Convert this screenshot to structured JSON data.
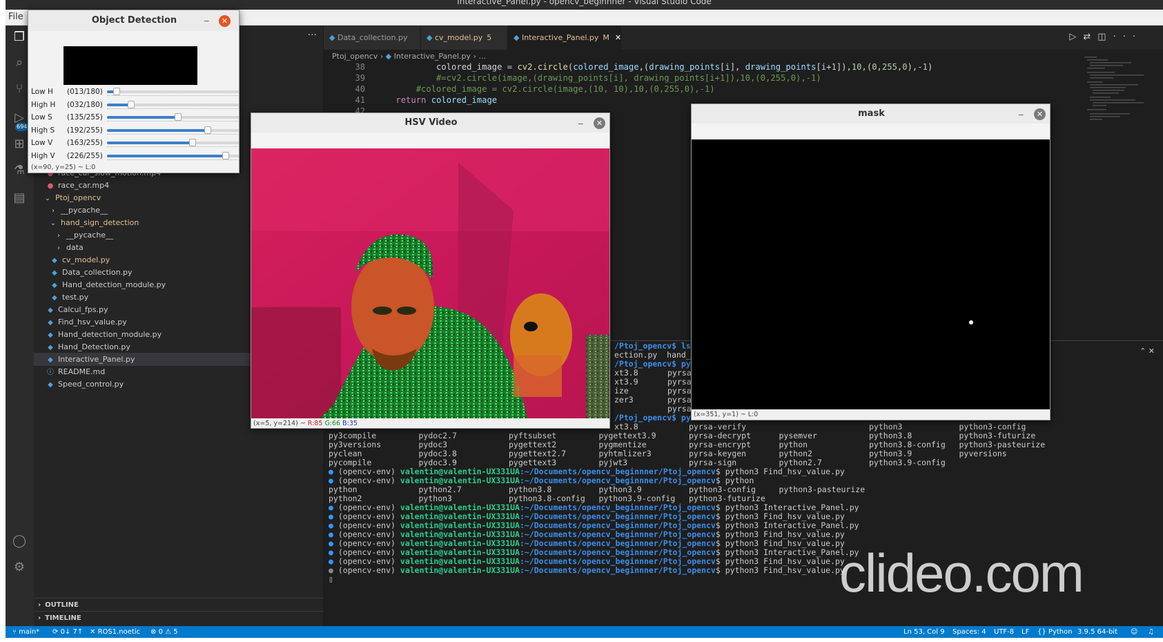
{
  "window_title": "Interactive_Panel.py - opencv_beginnner - Visual Studio Code",
  "menu": {
    "file": "File"
  },
  "activity": {
    "badge": "694"
  },
  "sidebar": {
    "more": "···",
    "files": [
      {
        "label": "race_car_slow_motion.mp4",
        "type": "mp4"
      },
      {
        "label": "race_car.mp4",
        "type": "mp4"
      },
      {
        "label": "Ptoj_opencv",
        "type": "folder-open"
      },
      {
        "label": "__pycache__",
        "type": "folder"
      },
      {
        "label": "hand_sign_detection",
        "type": "folder-open"
      },
      {
        "label": "__pycache__",
        "type": "folder"
      },
      {
        "label": "data",
        "type": "folder"
      },
      {
        "label": "cv_model.py",
        "type": "py"
      },
      {
        "label": "Data_collection.py",
        "type": "py"
      },
      {
        "label": "Hand_detection_module.py",
        "type": "py"
      },
      {
        "label": "test.py",
        "type": "py"
      },
      {
        "label": "Calcul_fps.py",
        "type": "py"
      },
      {
        "label": "Find_hsv_value.py",
        "type": "py"
      },
      {
        "label": "Hand_detection_module.py",
        "type": "py"
      },
      {
        "label": "Hand_Detection.py",
        "type": "py"
      },
      {
        "label": "Interactive_Panel.py",
        "type": "py"
      },
      {
        "label": "README.md",
        "type": "info"
      },
      {
        "label": "Speed_control.py",
        "type": "py"
      }
    ],
    "outline": "OUTLINE",
    "timeline": "TIMELINE"
  },
  "tabs": [
    {
      "label": "Data_collection.py",
      "status": ""
    },
    {
      "label": "cv_model.py",
      "status": "5"
    },
    {
      "label": "Interactive_Panel.py",
      "status": "M"
    }
  ],
  "breadcrumb": [
    "Ptoj_opencv",
    "Interactive_Panel.py",
    "..."
  ],
  "code": {
    "lines": [
      "38",
      "39",
      "40",
      "41",
      "42"
    ]
  },
  "terminal": {
    "prompt_prefix": "(opencv-env) ",
    "user": "valentin@valentin-UX331UA",
    "path": ":~/Documents/opencv_beginnner/Ptoj_opencv",
    "top_fragments": [
      "/Ptoj_opencv$ ls",
      "ection.py  hand_si",
      "/Ptoj_opencv$ py",
      "xt3.8",
      "xt3.9",
      "ize",
      "zer3",
      "/Ptoj_opencv$ py"
    ],
    "py_col": [
      "pyrsa-",
      "pyrsa-",
      "pyrsa-",
      "pyrsa-",
      "pyrsa-"
    ],
    "list1": [
      [
        "py3compile",
        "pydoc2.7",
        "pyftsubset",
        "pygettext3.9",
        "pyrsa-decrypt",
        "pysemver",
        "python3.8",
        "python3-futurize"
      ],
      [
        "py3versions",
        "pydoc3",
        "pygettext2",
        "pygmentize",
        "pyrsa-encrypt",
        "python",
        "python3.8-config",
        "python3-pasteurize"
      ],
      [
        "pyclean",
        "pydoc3.8",
        "pygettext2.7",
        "pyhtmlizer3",
        "pyrsa-keygen",
        "python2",
        "python3.9",
        "pyversions"
      ],
      [
        "pycompile",
        "pydoc3.9",
        "pygettext3",
        "pyjwt3",
        "pyrsa-sign",
        "python2.7",
        "python3.9-config",
        ""
      ]
    ],
    "list1_top": [
      "xt3.8",
      "",
      "",
      "",
      "pyrsa-verify",
      "",
      "python3",
      "python3-config"
    ],
    "cmd1": "python3 Find_hsv_value.py",
    "cmd2": "python",
    "list2": [
      [
        "python",
        "python2.7",
        "python3.8",
        "python3.9",
        "python3-config",
        "python3-pasteurize"
      ],
      [
        "python2",
        "python3",
        "python3.8-config",
        "python3.9-config",
        "python3-futurize",
        ""
      ]
    ],
    "history": [
      "python3 Interactive_Panel.py",
      "python3 Find_hsv_value.py",
      "python3 Interactive_Panel.py",
      "python3 Find_hsv_value.py",
      "python3 Find_hsv_value.py",
      "python3 Interactive_Panel.py",
      "python3 Find_hsv_value.py",
      "python3 Find_hsv_value.py"
    ]
  },
  "watermark": "clideo.com",
  "statusbar": {
    "branch": "main*",
    "sync": "0↓ 7↑",
    "ros": "ROS1.noetic",
    "problems": "0 ⚠ 5",
    "position": "Ln 53, Col 9",
    "spaces": "Spaces: 4",
    "encoding": "UTF-8",
    "eol": "LF",
    "language": "Python",
    "interpreter": "3.9.5 64-bit"
  },
  "object_detection": {
    "title": "Object Detection",
    "sliders": [
      {
        "label": "Low H",
        "value": "(013/180)",
        "level": 0.072
      },
      {
        "label": "High H",
        "value": "(032/180)",
        "level": 0.178
      },
      {
        "label": "Low S",
        "value": "(135/255)",
        "level": 0.529
      },
      {
        "label": "High S",
        "value": "(192/255)",
        "level": 0.753
      },
      {
        "label": "Low V",
        "value": "(163/255)",
        "level": 0.639
      },
      {
        "label": "High V",
        "value": "(226/255)",
        "level": 0.886
      }
    ],
    "info": "(x=90, y=25) ~ L:0"
  },
  "hsv_video": {
    "title": "HSV Video",
    "info_prefix": "(x=5, y=214) ~ ",
    "r": "R:85",
    "g": "G:66",
    "b": "B:35"
  },
  "mask": {
    "title": "mask",
    "info": "(x=351, y=1) ~ L:0"
  },
  "colors": {
    "status_bar": "#007acc",
    "accent_close": "#e95420",
    "hsv_magenta": "#d01d5a",
    "hsv_green": "#32d23a"
  }
}
